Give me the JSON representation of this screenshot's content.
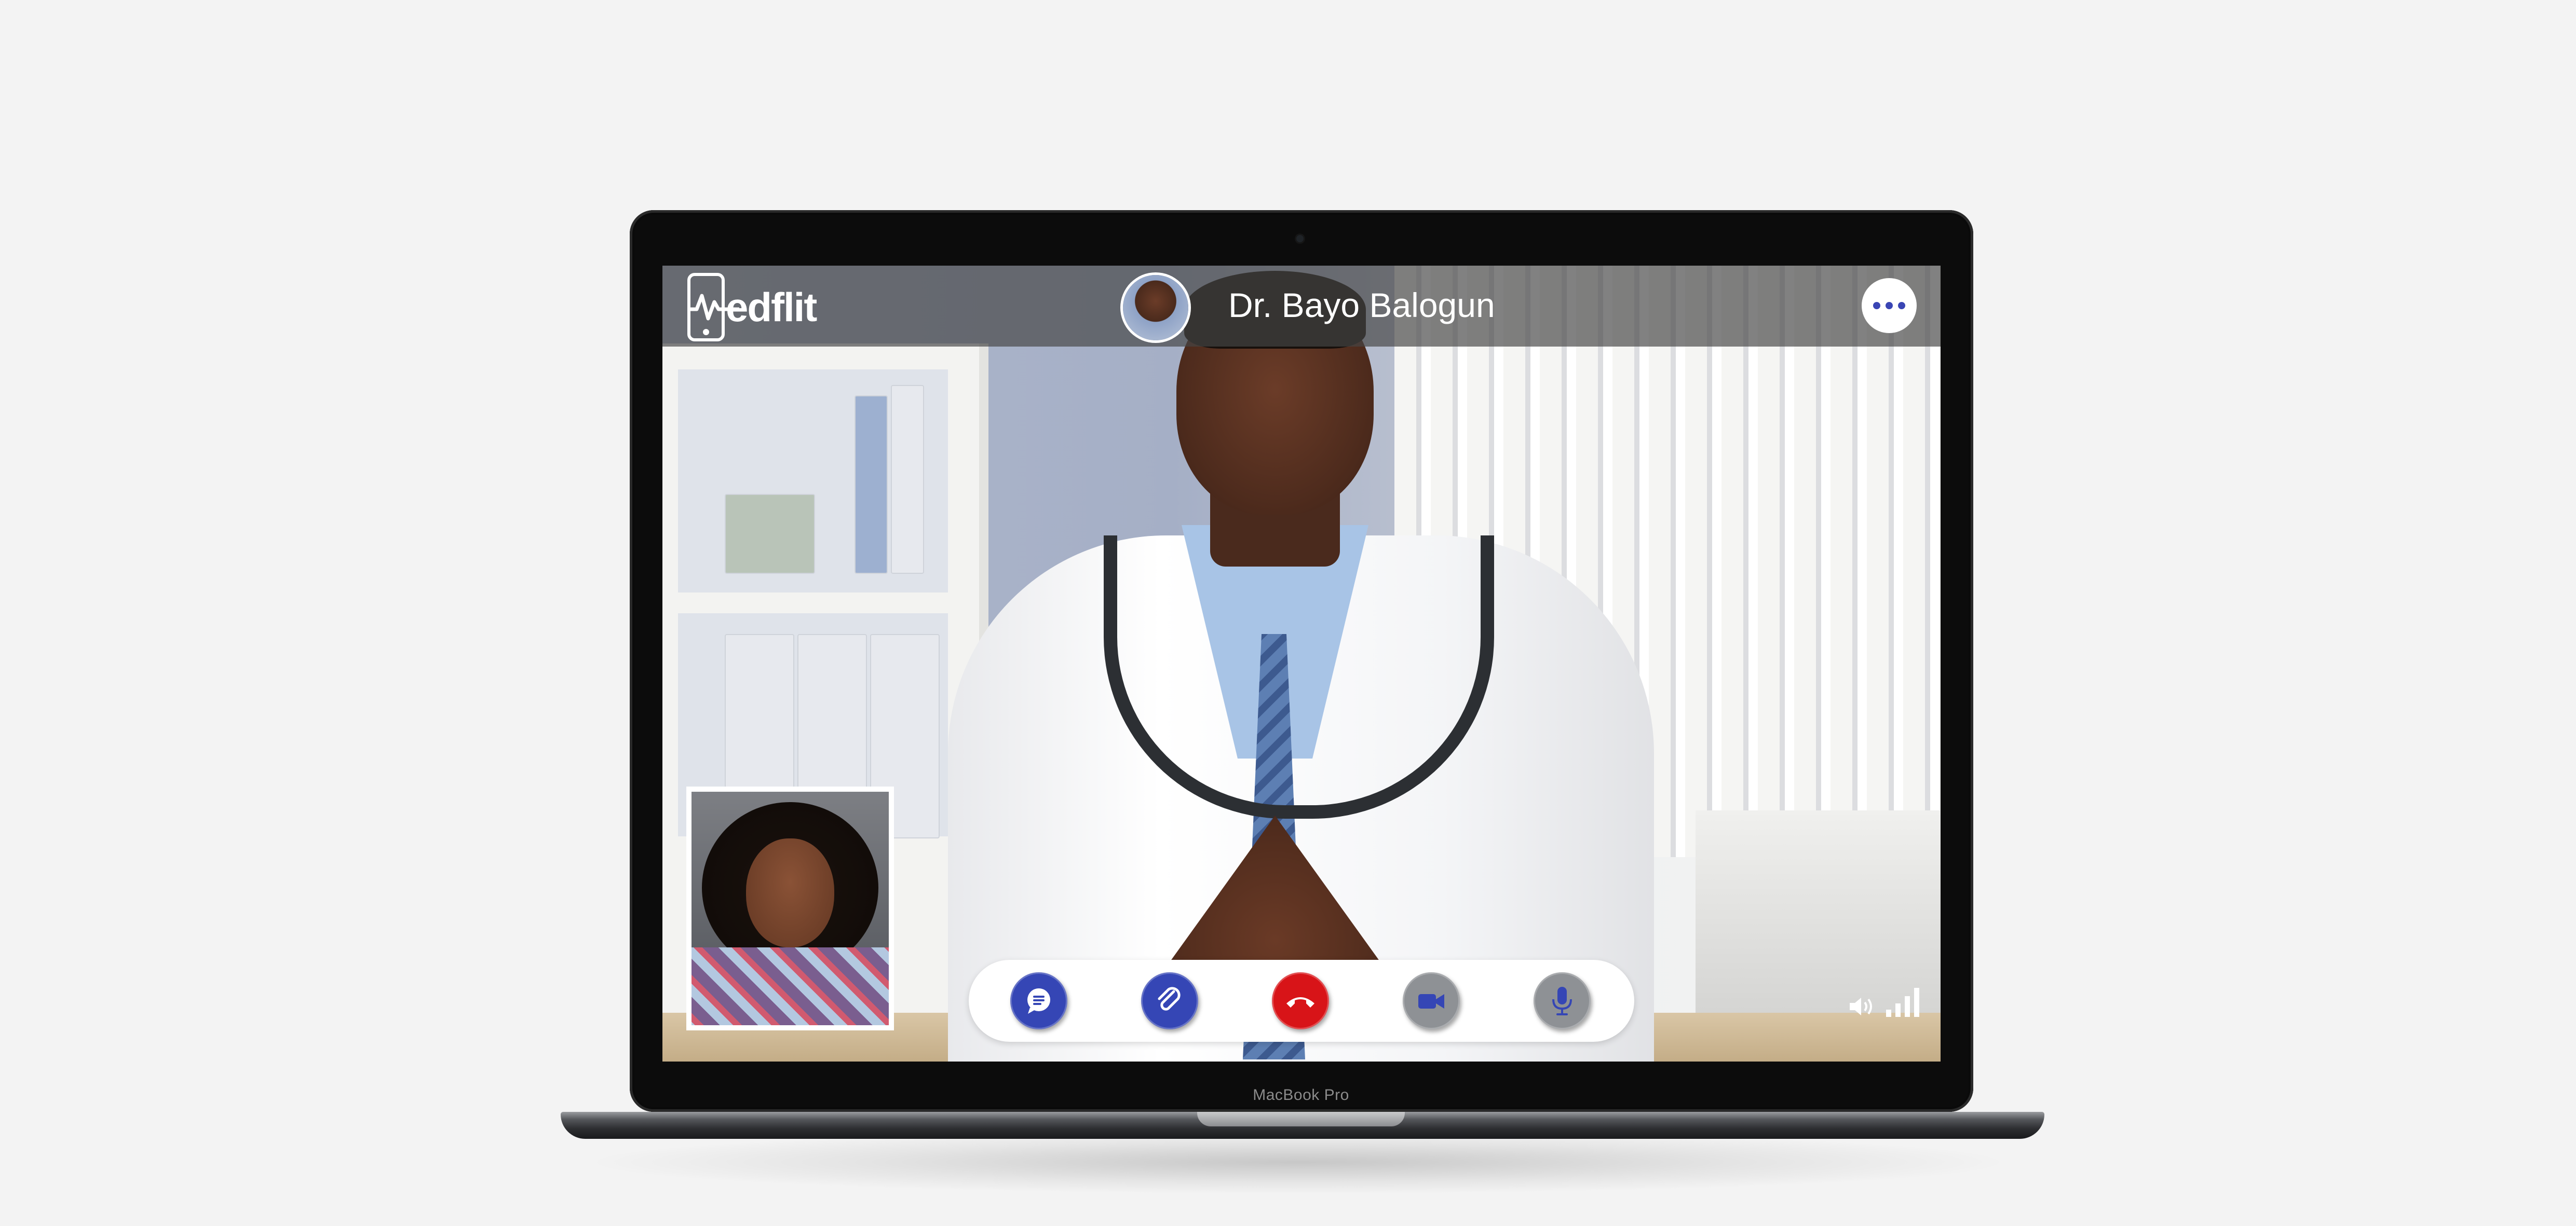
{
  "app": {
    "logo_text": "edflit",
    "logo_initial_icon": "phone-heartbeat-icon"
  },
  "call": {
    "caller_name": "Dr. Bayo Balogun",
    "caller_avatar": "doctor-avatar",
    "more_icon": "more-horizontal-icon",
    "self_view": "patient-self-view"
  },
  "controls": [
    {
      "name": "chat-button",
      "icon": "chat-bubble-icon",
      "color": "#3546b5"
    },
    {
      "name": "attach-button",
      "icon": "paperclip-icon",
      "color": "#3546b5"
    },
    {
      "name": "end-call-button",
      "icon": "phone-hangup-icon",
      "color": "#d81418"
    },
    {
      "name": "video-toggle-button",
      "icon": "video-camera-icon",
      "color": "#3546b5"
    },
    {
      "name": "mute-toggle-button",
      "icon": "microphone-icon",
      "color": "#3546b5"
    }
  ],
  "status": {
    "volume_icon": "speaker-volume-icon",
    "signal_icon": "signal-strength-icon",
    "signal_bars": 4
  },
  "device": {
    "label": "MacBook Pro"
  },
  "colors": {
    "accent": "#3546b5",
    "danger": "#d81418",
    "header_overlay": "#464646"
  }
}
